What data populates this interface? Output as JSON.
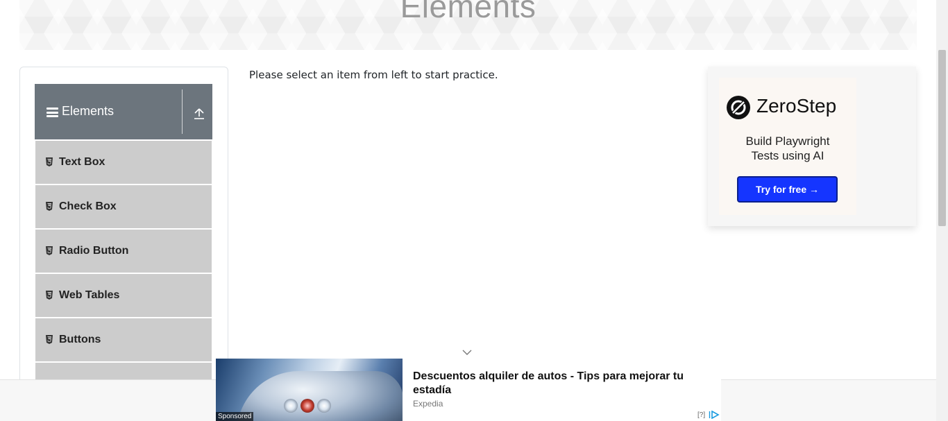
{
  "header": {
    "title": "Elements"
  },
  "sidebar": {
    "group_title": "Elements",
    "items": [
      {
        "label": "Text Box"
      },
      {
        "label": "Check Box"
      },
      {
        "label": "Radio Button"
      },
      {
        "label": "Web Tables"
      },
      {
        "label": "Buttons"
      },
      {
        "label": ""
      }
    ]
  },
  "main": {
    "message": "Please select an item from left to start practice."
  },
  "side_ad": {
    "brand": "ZeroStep",
    "tagline_line1": "Build Playwright",
    "tagline_line2": "Tests using AI",
    "cta": "Try for free →",
    "cta_color": "#1535ff"
  },
  "bottom_ad": {
    "sponsored_label": "Sponsored",
    "headline": "Descuentos alquiler de autos - Tips para mejorar tu estadía",
    "source": "Expedia",
    "help_label": "[?]"
  },
  "colors": {
    "group_header_bg": "#6c757d",
    "menu_item_bg": "#cccccc",
    "accent": "#1535ff"
  }
}
